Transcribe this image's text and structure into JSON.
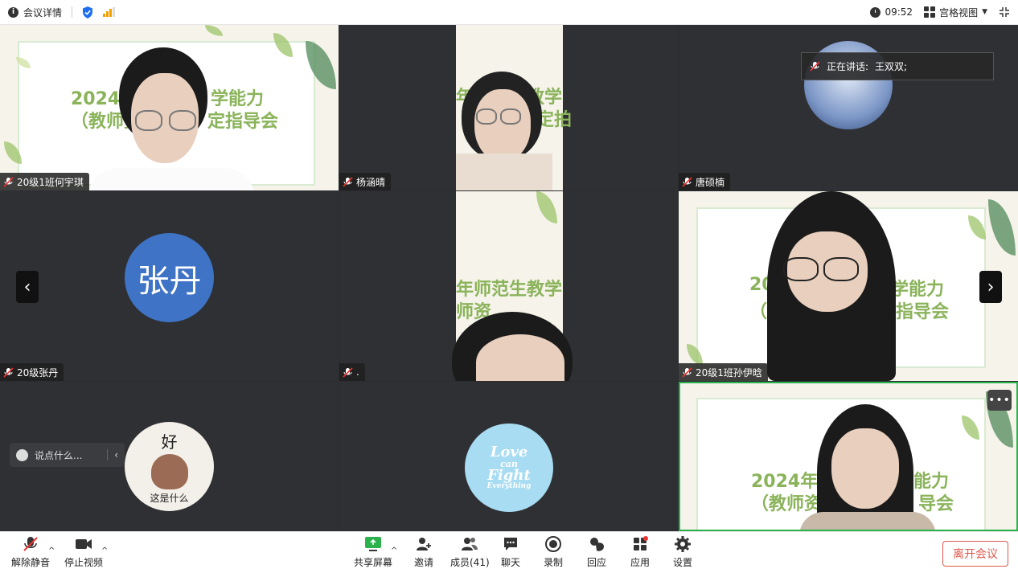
{
  "topbar": {
    "meeting_info": "会议详情",
    "time": "09:52",
    "view_mode": "宫格视图"
  },
  "speaking": {
    "label": "正在讲话:",
    "name": "王双双;"
  },
  "tiles": [
    {
      "name": "20级1班何宇琪",
      "slide_line1": "2024年",
      "slide_line1b": "学能力",
      "slide_line2": "（教师资",
      "slide_line2b": "定指导会"
    },
    {
      "name": "杨涵晴",
      "slide_line1": "年师范生教学",
      "slide_line2": "人定拍"
    },
    {
      "name": "唐硕楠"
    },
    {
      "name": "20级张丹",
      "avatar_text": "张丹"
    },
    {
      "name": ".",
      "slide_line1": "年师范生教学",
      "slide_line2": "师资"
    },
    {
      "name": "20级1班孙伊晗",
      "slide_line1": "202",
      "slide_line1b": "学能力",
      "slide_line2": "（教",
      "slide_line2b": "指导会"
    },
    {
      "name": "",
      "avatar_text_top": "好",
      "avatar_text_bottom": "这是什么"
    },
    {
      "name": "",
      "avatar_line1": "Love",
      "avatar_line2": "can",
      "avatar_line3": "Fight",
      "avatar_line4": "Everything"
    },
    {
      "name": "",
      "slide_line1": "2024年",
      "slide_line1b": "能力",
      "slide_line2": "（教师资",
      "slide_line2b": "导会"
    }
  ],
  "chat": {
    "placeholder": "说点什么..."
  },
  "more_label": "•••",
  "toolbar": {
    "unmute": "解除静音",
    "stop_video": "停止视频",
    "share_screen": "共享屏幕",
    "invite": "邀请",
    "members": "成员(41)",
    "chat": "聊天",
    "record": "录制",
    "reactions": "回应",
    "apps": "应用",
    "settings": "设置",
    "leave": "离开会议"
  },
  "colors": {
    "accent_green": "#2bb24c",
    "leave_red": "#e0574c",
    "avatar_blue": "#3f73c6",
    "avatar_cyan": "#a8dcf2"
  }
}
